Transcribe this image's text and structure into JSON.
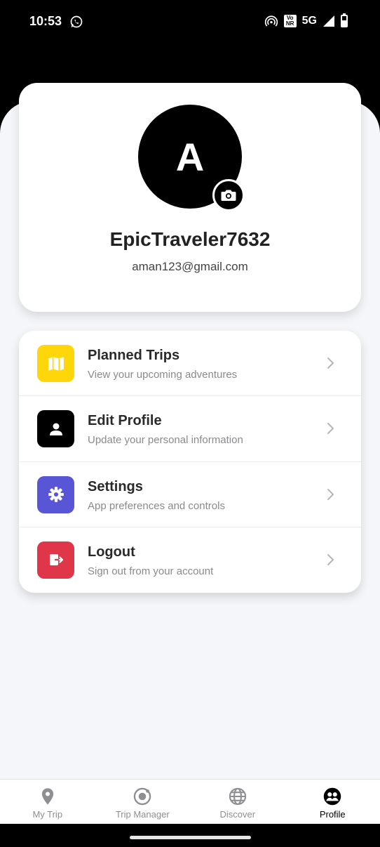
{
  "status_bar": {
    "time": "10:53",
    "volte_top": "Vo",
    "volte_bottom": "NR",
    "network": "5G"
  },
  "profile": {
    "initial": "A",
    "username": "EpicTraveler7632",
    "email": "aman123@gmail.com"
  },
  "menu": {
    "items": [
      {
        "title": "Planned Trips",
        "subtitle": "View your upcoming adventures",
        "icon": "map-icon",
        "color": "#FFD60A"
      },
      {
        "title": "Edit Profile",
        "subtitle": "Update your personal information",
        "icon": "user-icon",
        "color": "#000000"
      },
      {
        "title": "Settings",
        "subtitle": "App preferences and controls",
        "icon": "gear-icon",
        "color": "#5856D6"
      },
      {
        "title": "Logout",
        "subtitle": "Sign out from your account",
        "icon": "logout-icon",
        "color": "#E0364A"
      }
    ]
  },
  "tabs": [
    {
      "label": "My Trip",
      "icon": "location-pin-icon"
    },
    {
      "label": "Trip Manager",
      "icon": "ionic-icon"
    },
    {
      "label": "Discover",
      "icon": "globe-icon"
    },
    {
      "label": "Profile",
      "icon": "people-icon",
      "active": true
    }
  ]
}
